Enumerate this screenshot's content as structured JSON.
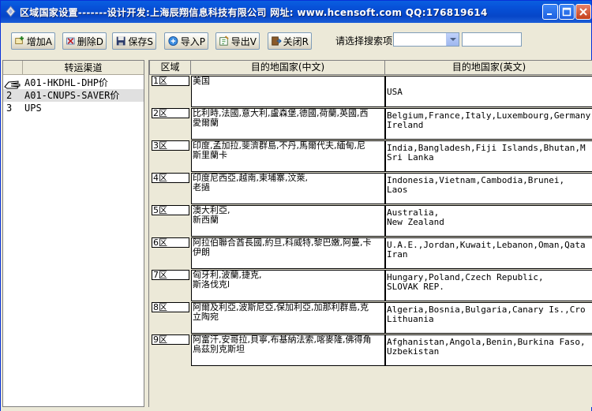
{
  "window": {
    "title": "区域国家设置-------设计开发:上海辰翔信息科技有限公司  网址: www.hcensoft.com  QQ:176819614"
  },
  "toolbar": {
    "buttons": [
      {
        "id": "add",
        "label": "增加A",
        "icon": "add-icon"
      },
      {
        "id": "delete",
        "label": "删除D",
        "icon": "delete-icon"
      },
      {
        "id": "save",
        "label": "保存S",
        "icon": "save-icon"
      },
      {
        "id": "import",
        "label": "导入P",
        "icon": "import-icon"
      },
      {
        "id": "export",
        "label": "导出V",
        "icon": "export-icon"
      },
      {
        "id": "close",
        "label": "关闭R",
        "icon": "close-icon"
      }
    ],
    "search_label": "请选择搜索项",
    "search_select_value": "",
    "search_input_value": ""
  },
  "channels": {
    "header": "转运渠道",
    "rows": [
      {
        "num": "",
        "name": "A01-HKDHL-DHP价"
      },
      {
        "num": "2",
        "name": "A01-CNUPS-SAVER价"
      },
      {
        "num": "3",
        "name": "UPS"
      }
    ]
  },
  "zones": {
    "headers": {
      "zone": "区域",
      "cn": "目的地国家(中文)",
      "en": "目的地国家(英文)"
    },
    "rows": [
      {
        "zone": "1区",
        "cn": "美国",
        "en": "USA"
      },
      {
        "zone": "2区",
        "cn": "比利時,法國,意大利,盧森堡,德國,荷蘭,英國,西\n愛爾蘭",
        "en": "Belgium,France,Italy,Luxembourg,Germany\nIreland"
      },
      {
        "zone": "3区",
        "cn": "印度,孟加拉,斐濟群島,不丹,馬爾代夫,緬甸,尼\n斯里蘭卡",
        "en": "India,Bangladesh,Fiji Islands,Bhutan,M\nSri Lanka"
      },
      {
        "zone": "4区",
        "cn": "印度尼西亞,越南,柬埔寨,汶萊,\n老撾",
        "en": "Indonesia,Vietnam,Cambodia,Brunei,\nLaos"
      },
      {
        "zone": "5区",
        "cn": "澳大利亞,\n新西蘭",
        "en": "Australia,\nNew Zealand"
      },
      {
        "zone": "6区",
        "cn": "阿拉伯聯合酋長國,約旦,科威特,黎巴嫩,阿曼,卡\n伊朗",
        "en": "U.A.E.,Jordan,Kuwait,Lebanon,Oman,Qata\nIran"
      },
      {
        "zone": "7区",
        "cn": "匈牙利,波蘭,捷克,\n斯洛伐克l",
        "en": "Hungary,Poland,Czech Republic,\nSLOVAK REP."
      },
      {
        "zone": "8区",
        "cn": "阿爾及利亞,波斯尼亞,保加利亞,加那利群島,克\n立陶宛",
        "en": "Algeria,Bosnia,Bulgaria,Canary Is.,Cro\nLithuania"
      },
      {
        "zone": "9区",
        "cn": "阿富汗,安哥拉,貝寧,布基納法索,喀麥隆,佛得角\n烏茲別克斯坦",
        "en": "Afghanistan,Angola,Benin,Burkina Faso,\nUzbekistan"
      }
    ]
  },
  "colors": {
    "titlebar": "#0a5fe0",
    "face": "#ece9d8",
    "grid_border": "#000000"
  }
}
